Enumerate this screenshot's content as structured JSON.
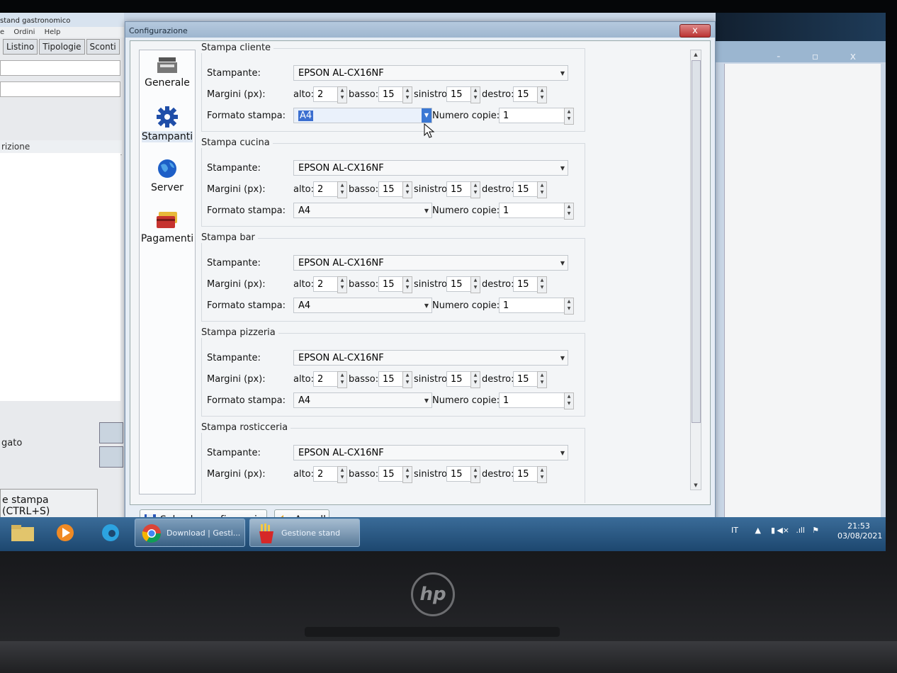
{
  "background_app": {
    "title": "stand gastronomico",
    "menu": [
      "e",
      "Ordini",
      "Help"
    ],
    "tabs": [
      "Listino",
      "Tipologie",
      "Sconti"
    ],
    "column_header": "rizione",
    "pagato_label": "gato",
    "stampa_button": "e stampa (CTRL+S)"
  },
  "dialog": {
    "title": "Configurazione",
    "close_label": "x",
    "sidebar": [
      {
        "label": "Generale",
        "icon": "cash-register-icon"
      },
      {
        "label": "Stampanti",
        "icon": "gear-icon",
        "active": true
      },
      {
        "label": "Server",
        "icon": "globe-icon"
      },
      {
        "label": "Pagamenti",
        "icon": "credit-card-icon"
      }
    ],
    "labels": {
      "stampante": "Stampante:",
      "margini": "Margini (px):",
      "alto": "alto:",
      "basso": "basso:",
      "sinistro": "sinistro:",
      "destro": "destro:",
      "formato": "Formato stampa:",
      "copie": "Numero copie:"
    },
    "sections": [
      {
        "title": "Stampa cliente",
        "printer": "EPSON AL-CX16NF",
        "alto": "2",
        "basso": "15",
        "sinistro": "15",
        "destro": "15",
        "format": "A4",
        "copies": "1"
      },
      {
        "title": "Stampa cucina",
        "printer": "EPSON AL-CX16NF",
        "alto": "2",
        "basso": "15",
        "sinistro": "15",
        "destro": "15",
        "format": "A4",
        "copies": "1"
      },
      {
        "title": "Stampa bar",
        "printer": "EPSON AL-CX16NF",
        "alto": "2",
        "basso": "15",
        "sinistro": "15",
        "destro": "15",
        "format": "A4",
        "copies": "1"
      },
      {
        "title": "Stampa pizzeria",
        "printer": "EPSON AL-CX16NF",
        "alto": "2",
        "basso": "15",
        "sinistro": "15",
        "destro": "15",
        "format": "A4",
        "copies": "1"
      },
      {
        "title": "Stampa rosticceria",
        "printer": "EPSON AL-CX16NF",
        "alto": "2",
        "basso": "15",
        "sinistro": "15",
        "destro": "15",
        "format": "",
        "copies": ""
      }
    ],
    "save_button": "Salva la configurazione",
    "cancel_button": "Annulla"
  },
  "taskbar": {
    "items": [
      {
        "label": "Download | Gesti...",
        "icon": "chrome-icon"
      },
      {
        "label": "Gestione stand ga...",
        "icon": "fries-icon"
      }
    ],
    "lang": "IT",
    "time": "21:53",
    "date": "03/08/2021"
  },
  "colors": {
    "accent": "#3b78d4",
    "taskbar": "#2a5a87"
  }
}
